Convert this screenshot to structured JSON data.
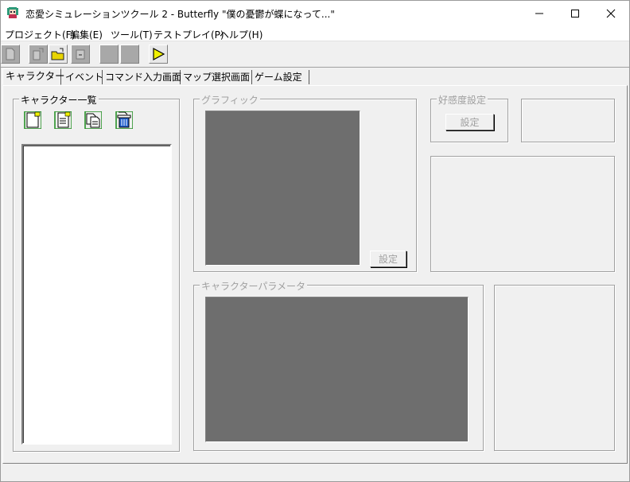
{
  "window": {
    "title": "恋愛シミュレーションツクール 2  - Butterfly \"僕の憂鬱が蝶になって...\""
  },
  "menu": [
    {
      "label": "プロジェクト(F)"
    },
    {
      "label": "編集(E)"
    },
    {
      "label": "ツール(T)"
    },
    {
      "label": "テストプレイ(P)"
    },
    {
      "label": "ヘルプ(H)"
    }
  ],
  "tabs": [
    {
      "label": "キャラクター",
      "active": true
    },
    {
      "label": "イベント"
    },
    {
      "label": "コマンド入力画面"
    },
    {
      "label": "マップ選択画面"
    },
    {
      "label": "ゲーム設定"
    }
  ],
  "character_list": {
    "title": "キャラクター一覧"
  },
  "graphic": {
    "title": "グラフィック",
    "button": "設定"
  },
  "affinity": {
    "title": "好感度設定",
    "button": "設定"
  },
  "parameters": {
    "title": "キャラクターパラメータ"
  },
  "colors": {
    "preview": "#6e6e6e",
    "disabled_text": "#a0a0a0",
    "play_icon": "#f0f000"
  },
  "icons": {
    "toolbar": [
      "new-doc-icon",
      "open-doc-icon",
      "open-folder-icon",
      "save-icon",
      "blank-icon",
      "blank-icon",
      "play-icon"
    ],
    "character_list": [
      "new-character-icon",
      "edit-character-icon",
      "copy-character-icon",
      "delete-character-icon"
    ]
  }
}
